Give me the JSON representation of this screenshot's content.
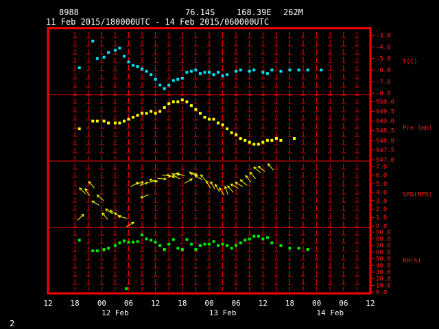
{
  "header": {
    "station_id": "8988",
    "lat": "76.14S",
    "lon": "168.39E",
    "elev": "262M",
    "period": "11 Feb 2015/180000UTC - 14 Feb 2015/060000UTC"
  },
  "page_number": "2",
  "colors": {
    "frame": "#ff0000",
    "temperature": "#00e5ff",
    "pressure": "#ffff00",
    "wind": "#ffff00",
    "rh": "#00ee00",
    "text": "#ffffff"
  },
  "chart_data": {
    "type": "scatter",
    "x_unit": "hours after 11 Feb 2015 12 UTC",
    "x_range": [
      0,
      72
    ],
    "x_tick_labels": [
      "12",
      "18",
      "00",
      "06",
      "12",
      "18",
      "00",
      "06",
      "12",
      "18",
      "00",
      "06",
      "12"
    ],
    "date_labels": [
      {
        "label": "12 Feb",
        "x": 15
      },
      {
        "label": "13 Feb",
        "x": 39
      },
      {
        "label": "14 Feb",
        "x": 63
      }
    ],
    "panels": [
      {
        "name": "T(C)",
        "ylim": [
          -8.0,
          -2.5
        ],
        "y_ticks": [
          -3.0,
          -4.0,
          -5.0,
          -6.0,
          -7.0,
          -8.0
        ],
        "y_tick_labels": [
          "-3.0",
          "-4.0",
          "-5.0",
          "-6.0",
          "-7.0",
          "-8.0"
        ],
        "points": [
          [
            7,
            -5.8
          ],
          [
            10,
            -3.5
          ],
          [
            11,
            -5.0
          ],
          [
            12.5,
            -4.9
          ],
          [
            13.5,
            -4.5
          ],
          [
            15,
            -4.3
          ],
          [
            16,
            -4.1
          ],
          [
            17,
            -4.8
          ],
          [
            18,
            -5.3
          ],
          [
            19,
            -5.6
          ],
          [
            20,
            -5.7
          ],
          [
            21,
            -5.9
          ],
          [
            22,
            -6.1
          ],
          [
            23,
            -6.4
          ],
          [
            24,
            -6.8
          ],
          [
            25,
            -7.3
          ],
          [
            26,
            -7.6
          ],
          [
            27,
            -7.3
          ],
          [
            28,
            -6.9
          ],
          [
            29,
            -6.8
          ],
          [
            30,
            -6.7
          ],
          [
            31,
            -6.2
          ],
          [
            32,
            -6.1
          ],
          [
            33,
            -6.0
          ],
          [
            34,
            -6.3
          ],
          [
            35,
            -6.2
          ],
          [
            36,
            -6.2
          ],
          [
            37,
            -6.4
          ],
          [
            38,
            -6.2
          ],
          [
            39,
            -6.5
          ],
          [
            40,
            -6.4
          ],
          [
            42,
            -6.1
          ],
          [
            43,
            -6.0
          ],
          [
            45,
            -6.1
          ],
          [
            46,
            -6.0
          ],
          [
            48,
            -6.2
          ],
          [
            49,
            -6.3
          ],
          [
            50,
            -6.0
          ],
          [
            52,
            -6.1
          ],
          [
            54,
            -6.0
          ],
          [
            56,
            -6.0
          ],
          [
            58,
            -6.0
          ],
          [
            61,
            -6.0
          ]
        ]
      },
      {
        "name": "Pre (mb)",
        "ylim": [
          947.0,
          950.3
        ],
        "y_ticks": [
          950.0,
          949.5,
          949.0,
          948.5,
          948.0,
          947.5,
          947.0
        ],
        "y_tick_labels": [
          "950.0",
          "949.5",
          "949.0",
          "948.5",
          "948.0",
          "947.5",
          "947.0"
        ],
        "points": [
          [
            7,
            948.6
          ],
          [
            10,
            949.0
          ],
          [
            11,
            949.0
          ],
          [
            12.5,
            949.0
          ],
          [
            13.5,
            948.9
          ],
          [
            15,
            948.9
          ],
          [
            16,
            948.9
          ],
          [
            17,
            949.0
          ],
          [
            18,
            949.1
          ],
          [
            19,
            949.2
          ],
          [
            20,
            949.3
          ],
          [
            21,
            949.4
          ],
          [
            22,
            949.4
          ],
          [
            23,
            949.5
          ],
          [
            24,
            949.4
          ],
          [
            25,
            949.5
          ],
          [
            26,
            949.7
          ],
          [
            27,
            949.9
          ],
          [
            28,
            950.0
          ],
          [
            29,
            950.0
          ],
          [
            30,
            950.1
          ],
          [
            31,
            950.0
          ],
          [
            32,
            949.8
          ],
          [
            33,
            949.6
          ],
          [
            34,
            949.4
          ],
          [
            35,
            949.2
          ],
          [
            36,
            949.1
          ],
          [
            37,
            949.1
          ],
          [
            38,
            948.9
          ],
          [
            39,
            948.8
          ],
          [
            40,
            948.6
          ],
          [
            41,
            948.4
          ],
          [
            42,
            948.3
          ],
          [
            43,
            948.1
          ],
          [
            44,
            948.0
          ],
          [
            45,
            947.9
          ],
          [
            46,
            947.8
          ],
          [
            47,
            947.8
          ],
          [
            48,
            947.9
          ],
          [
            49,
            948.0
          ],
          [
            50,
            948.0
          ],
          [
            51,
            948.1
          ],
          [
            52,
            948.0
          ],
          [
            55,
            948.1
          ]
        ]
      },
      {
        "name": "SPD(MPS)",
        "ylim": [
          0.0,
          7.5
        ],
        "y_ticks": [
          7.0,
          6.0,
          5.0,
          4.0,
          3.0,
          2.0,
          1.0,
          0.0
        ],
        "y_tick_labels": [
          "7.0",
          "6.0",
          "5.0",
          "4.0",
          "3.0",
          "2.0",
          "1.0",
          "0.0"
        ],
        "barbs": [
          [
            7,
            0.9,
            45
          ],
          [
            8,
            4.0,
            315
          ],
          [
            9,
            3.8,
            330
          ],
          [
            10,
            4.7,
            320
          ],
          [
            11,
            2.6,
            300
          ],
          [
            12,
            3.2,
            310
          ],
          [
            13,
            1.0,
            320
          ],
          [
            14,
            1.6,
            305
          ],
          [
            15,
            1.5,
            300
          ],
          [
            16,
            1.2,
            300
          ],
          [
            17,
            1.0,
            285
          ],
          [
            18,
            0.1,
            60
          ],
          [
            19,
            4.8,
            60
          ],
          [
            20,
            5.0,
            75
          ],
          [
            21,
            4.9,
            70
          ],
          [
            22,
            3.6,
            250
          ],
          [
            23,
            5.2,
            80
          ],
          [
            24,
            5.3,
            285
          ],
          [
            25,
            5.6,
            95
          ],
          [
            26,
            6.0,
            100
          ],
          [
            27,
            6.0,
            110
          ],
          [
            28,
            6.2,
            100
          ],
          [
            29,
            5.7,
            300
          ],
          [
            30,
            6.0,
            290
          ],
          [
            31,
            5.2,
            60
          ],
          [
            32,
            6.3,
            110
          ],
          [
            33,
            6.0,
            290
          ],
          [
            34,
            5.6,
            300
          ],
          [
            35,
            5.5,
            320
          ],
          [
            36,
            4.7,
            330
          ],
          [
            37,
            4.6,
            330
          ],
          [
            38,
            4.3,
            330
          ],
          [
            39,
            3.9,
            330
          ],
          [
            40,
            4.0,
            340
          ],
          [
            41,
            4.2,
            320
          ],
          [
            42,
            4.6,
            300
          ],
          [
            43,
            4.8,
            300
          ],
          [
            44,
            5.0,
            310
          ],
          [
            45,
            5.4,
            320
          ],
          [
            46,
            5.8,
            320
          ],
          [
            47,
            6.5,
            310
          ],
          [
            48,
            6.6,
            310
          ],
          [
            50,
            6.8,
            320
          ]
        ]
      },
      {
        "name": "RH(%)",
        "ylim": [
          0.0,
          95.0
        ],
        "y_ticks": [
          90.0,
          80.0,
          70.0,
          60.0,
          50.0,
          40.0,
          30.0,
          20.0,
          10.0,
          0.0
        ],
        "y_tick_labels": [
          "90.0",
          "80.0",
          "70.0",
          "60.0",
          "50.0",
          "40.0",
          "30.0",
          "20.0",
          "10.0",
          "0.0"
        ],
        "points": [
          [
            7,
            78
          ],
          [
            10,
            62
          ],
          [
            11,
            62
          ],
          [
            12.5,
            64
          ],
          [
            13.5,
            66
          ],
          [
            15,
            70
          ],
          [
            16,
            74
          ],
          [
            17,
            77
          ],
          [
            18,
            75
          ],
          [
            19,
            75
          ],
          [
            20,
            76
          ],
          [
            21,
            86
          ],
          [
            22,
            80
          ],
          [
            23,
            78
          ],
          [
            24,
            75
          ],
          [
            25,
            70
          ],
          [
            26,
            64
          ],
          [
            27,
            72
          ],
          [
            28,
            79
          ],
          [
            29,
            66
          ],
          [
            30,
            64
          ],
          [
            31,
            79
          ],
          [
            32,
            72
          ],
          [
            33,
            64
          ],
          [
            34,
            70
          ],
          [
            35,
            72
          ],
          [
            36,
            72
          ],
          [
            37,
            76
          ],
          [
            38,
            70
          ],
          [
            39,
            72
          ],
          [
            40,
            70
          ],
          [
            41,
            66
          ],
          [
            42,
            70
          ],
          [
            43,
            74
          ],
          [
            44,
            78
          ],
          [
            45,
            80
          ],
          [
            46,
            84
          ],
          [
            47,
            84
          ],
          [
            48,
            80
          ],
          [
            49,
            82
          ],
          [
            50,
            74
          ],
          [
            52,
            70
          ],
          [
            54,
            66
          ],
          [
            56,
            66
          ],
          [
            58,
            64
          ],
          [
            17.5,
            5
          ]
        ]
      }
    ]
  }
}
